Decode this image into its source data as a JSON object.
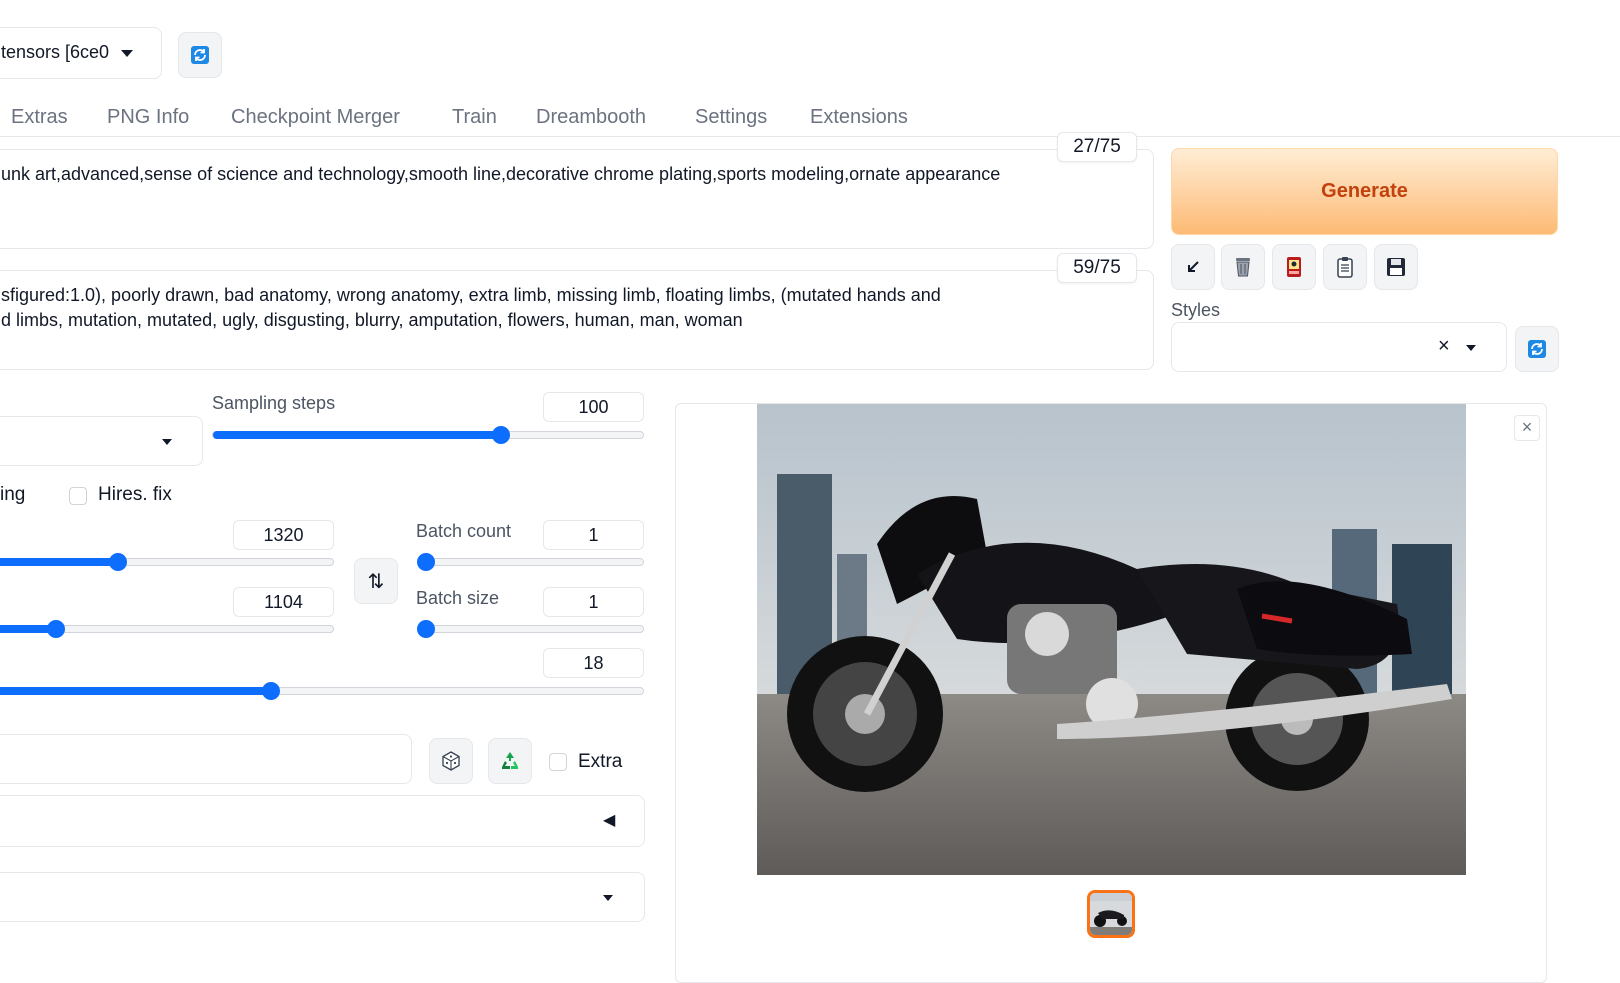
{
  "checkpoint": {
    "value": "tensors [6ce0"
  },
  "tabs": [
    "Extras",
    "PNG Info",
    "Checkpoint Merger",
    "Train",
    "Dreambooth",
    "Settings",
    "Extensions"
  ],
  "prompt": {
    "text": "unk art,advanced,sense of science and technology,smooth line,decorative chrome plating,sports modeling,ornate appearance",
    "counter": "27/75"
  },
  "negative_prompt": {
    "line1": "sfigured:1.0), poorly drawn, bad anatomy, wrong anatomy, extra limb, missing limb, floating limbs, (mutated hands and",
    "line2": "d limbs, mutation, mutated, ugly, disgusting, blurry, amputation, flowers, human, man, woman",
    "counter": "59/75"
  },
  "generate": {
    "label": "Generate"
  },
  "styles": {
    "label": "Styles",
    "clear": "×"
  },
  "sampling_steps": {
    "label": "Sampling steps",
    "value": "100",
    "fraction": 0.67
  },
  "options": {
    "restore_partial": "ing",
    "hires_label": "Hires. fix"
  },
  "width": {
    "value": "1320",
    "fraction": 0.37
  },
  "height": {
    "value": "1104",
    "fraction": 0.19
  },
  "swap_icon": "⇅",
  "batch_count": {
    "label": "Batch count",
    "value": "1",
    "fraction": 0.0
  },
  "batch_size": {
    "label": "Batch size",
    "value": "1",
    "fraction": 0.0
  },
  "cfg": {
    "value": "18",
    "fraction": 0.43
  },
  "seed": {
    "extra_label": "Extra"
  },
  "accordion": {
    "icon": "◀"
  },
  "gallery": {
    "close": "×"
  },
  "colors": {
    "accent": "#0d6efd",
    "generate_bg": "#fdba74",
    "generate_text": "#c2410c",
    "thumb_border": "#f97316"
  }
}
